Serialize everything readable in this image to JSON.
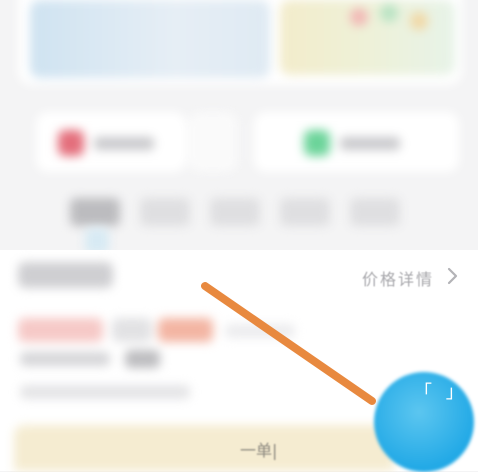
{
  "section": {
    "price_detail_label": "价格详情",
    "chevron_icon": "chevron-right-icon"
  },
  "bottom_bar": {
    "text": "一单|"
  },
  "fab": {
    "icon": "scan-icon",
    "glyph": "「 」"
  },
  "annotation": {
    "arrow_color": "#e8893f"
  }
}
